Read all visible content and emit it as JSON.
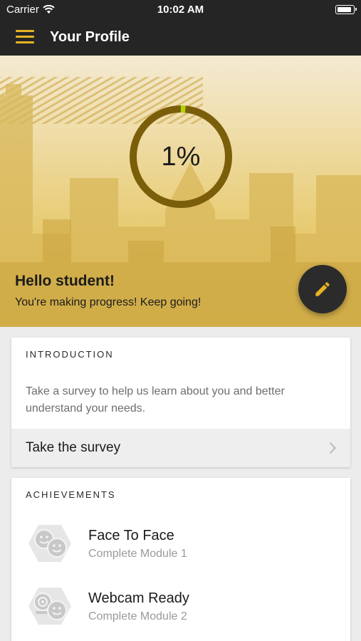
{
  "status_bar": {
    "carrier": "Carrier",
    "time": "10:02 AM"
  },
  "nav": {
    "title": "Your Profile"
  },
  "hero": {
    "progress_label": "1%",
    "progress_fraction": 0.01,
    "greeting": "Hello student!",
    "subtitle": "You're making progress! Keep going!",
    "colors": {
      "ring_track": "#7a5e0a",
      "ring_progress": "#b5d400",
      "accent": "#e6b422"
    }
  },
  "intro_card": {
    "heading": "INTRODUCTION",
    "description": "Take a survey to help us learn about you and better understand your needs.",
    "action_label": "Take the survey"
  },
  "achievements_card": {
    "heading": "ACHIEVEMENTS",
    "items": [
      {
        "title": "Face To Face",
        "subtitle": "Complete Module 1",
        "icon": "face-to-face-icon"
      },
      {
        "title": "Webcam Ready",
        "subtitle": "Complete Module 2",
        "icon": "webcam-ready-icon"
      }
    ]
  }
}
